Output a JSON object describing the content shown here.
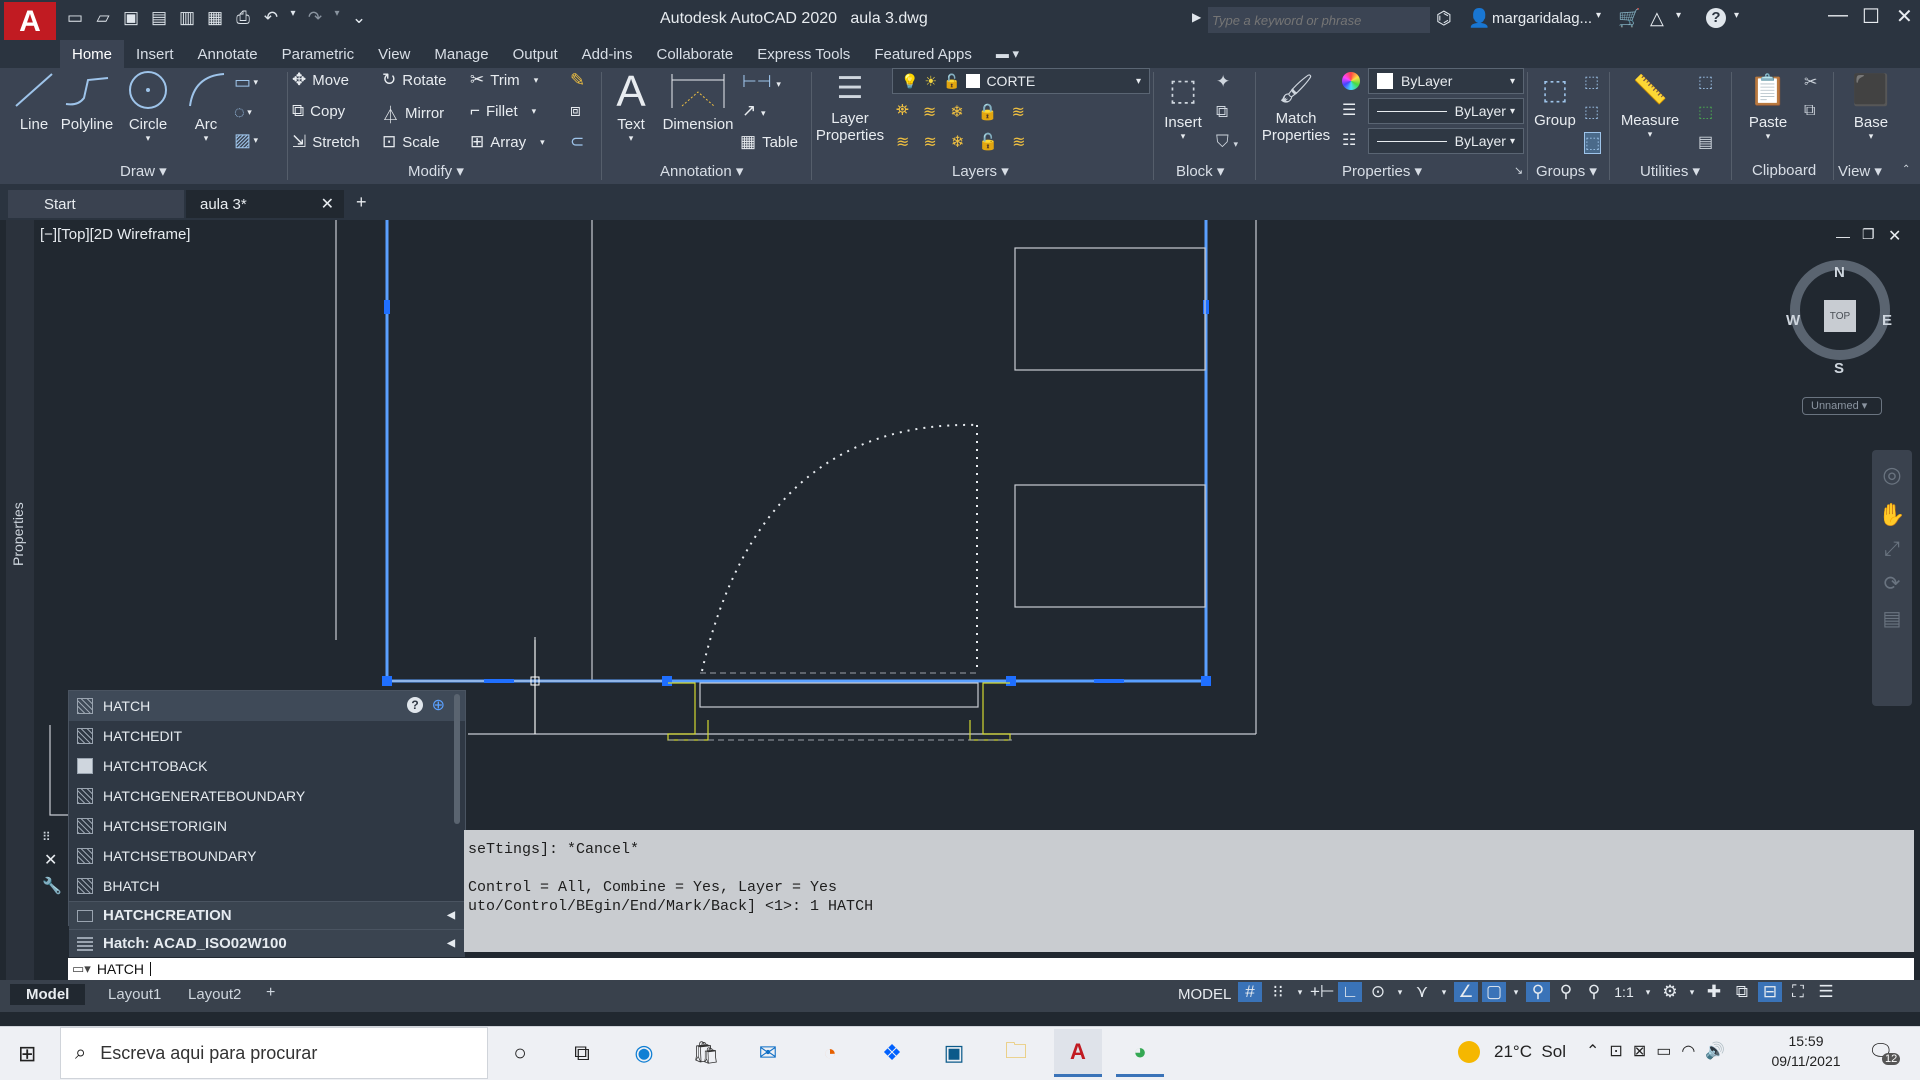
{
  "app": {
    "title": "Autodesk AutoCAD 2020",
    "filename": "aula 3.dwg",
    "search_placeholder": "Type a keyword or phrase",
    "user": "margaridalag...",
    "logo_letter": "A"
  },
  "ribbon_tabs": [
    "Home",
    "Insert",
    "Annotate",
    "Parametric",
    "View",
    "Manage",
    "Output",
    "Add-ins",
    "Collaborate",
    "Express Tools",
    "Featured Apps"
  ],
  "draw": {
    "line": "Line",
    "polyline": "Polyline",
    "circle": "Circle",
    "arc": "Arc",
    "panel": "Draw"
  },
  "modify": {
    "move": "Move",
    "rotate": "Rotate",
    "trim": "Trim",
    "copy": "Copy",
    "mirror": "Mirror",
    "fillet": "Fillet",
    "stretch": "Stretch",
    "scale": "Scale",
    "array": "Array",
    "panel": "Modify"
  },
  "annotation": {
    "text": "Text",
    "dimension": "Dimension",
    "table": "Table",
    "panel": "Annotation"
  },
  "layers": {
    "layer_properties_1": "Layer",
    "layer_properties_2": "Properties",
    "current_layer": "CORTE",
    "panel": "Layers"
  },
  "block": {
    "insert": "Insert",
    "panel": "Block"
  },
  "properties": {
    "match_1": "Match",
    "match_2": "Properties",
    "color": "ByLayer",
    "linetype": "ByLayer",
    "lineweight": "ByLayer",
    "panel": "Properties"
  },
  "groups": {
    "group": "Group",
    "panel": "Groups"
  },
  "utilities": {
    "measure": "Measure",
    "panel": "Utilities"
  },
  "clipboard": {
    "paste": "Paste",
    "panel": "Clipboard"
  },
  "view": {
    "base": "Base",
    "panel": "View"
  },
  "file_tabs": {
    "start": "Start",
    "current": "aula 3*",
    "add": "+"
  },
  "viewport": {
    "label": "[−][Top][2D Wireframe]",
    "properties_palette": "Properties"
  },
  "viewcube": {
    "n": "N",
    "s": "S",
    "e": "E",
    "w": "W",
    "top": "TOP",
    "ucs": "Unnamed"
  },
  "autocomplete": {
    "items": [
      "HATCH",
      "HATCHEDIT",
      "HATCHTOBACK",
      "HATCHGENERATEBOUNDARY",
      "HATCHSETORIGIN",
      "HATCHSETBOUNDARY",
      "BHATCH"
    ],
    "groups": [
      "HATCHCREATION",
      "Hatch: ACAD_ISO02W100"
    ]
  },
  "command_history": {
    "line1": "seTtings]: *Cancel*",
    "line2": "",
    "line3": " Control = All, Combine = Yes, Layer = Yes",
    "line4": "uto/Control/BEgin/End/Mark/Back] <1>: 1 HATCH"
  },
  "command_input": "HATCH",
  "layout_tabs": [
    "Model",
    "Layout1",
    "Layout2",
    "+"
  ],
  "status": {
    "model": "MODEL",
    "scale": "1:1"
  },
  "taskbar": {
    "search_placeholder": "Escreva aqui para procurar",
    "weather": "21°C  Sol",
    "time": "15:59",
    "date": "09/11/2021",
    "notifications": "12"
  }
}
